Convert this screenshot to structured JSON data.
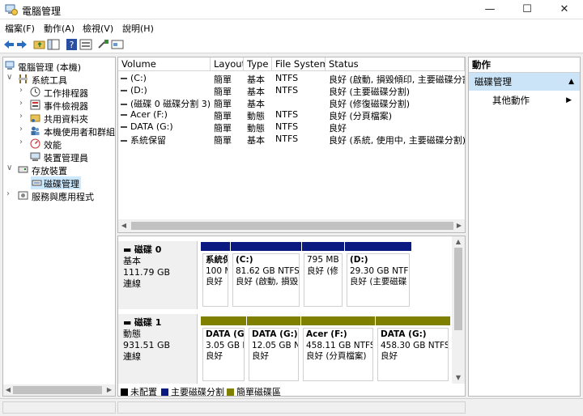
{
  "window": {
    "title": "電腦管理",
    "min": "—",
    "max": "☐",
    "close": "✕"
  },
  "menu": [
    "檔案(F)",
    "動作(A)",
    "檢視(V)",
    "說明(H)"
  ],
  "tree": {
    "root": "電腦管理 (本機)",
    "system_tools": "系統工具",
    "task_scheduler": "工作排程器",
    "event_viewer": "事件檢視器",
    "shared_folders": "共用資料夾",
    "local_users": "本機使用者和群組",
    "performance": "效能",
    "device_manager": "裝置管理員",
    "storage": "存放裝置",
    "disk_management": "磁碟管理",
    "services": "服務與應用程式"
  },
  "list": {
    "columns": [
      "Volume",
      "Layout",
      "Type",
      "File System",
      "Status"
    ],
    "rows": [
      {
        "volume": "(C:)",
        "layout": "簡單",
        "type": "基本",
        "fs": "NTFS",
        "status": "良好 (啟動, 損毀傾印, 主要磁碟分割)"
      },
      {
        "volume": "(D:)",
        "layout": "簡單",
        "type": "基本",
        "fs": "NTFS",
        "status": "良好 (主要磁碟分割)"
      },
      {
        "volume": "(磁碟 0 磁碟分割 3)",
        "layout": "簡單",
        "type": "基本",
        "fs": "",
        "status": "良好 (修復磁碟分割)"
      },
      {
        "volume": "Acer (F:)",
        "layout": "簡單",
        "type": "動態",
        "fs": "NTFS",
        "status": "良好 (分頁檔案)"
      },
      {
        "volume": "DATA (G:)",
        "layout": "簡單",
        "type": "動態",
        "fs": "NTFS",
        "status": "良好"
      },
      {
        "volume": "系統保留",
        "layout": "簡單",
        "type": "基本",
        "fs": "NTFS",
        "status": "良好 (系統, 使用中, 主要磁碟分割)"
      }
    ]
  },
  "disks": [
    {
      "name": "磁碟 0",
      "kind": "基本",
      "size": "111.79 GB",
      "state": "連線",
      "parts": [
        {
          "name": "系統保",
          "size": "100 M",
          "status": "良好"
        },
        {
          "name": "(C:)",
          "size": "81.62 GB NTFS",
          "status": "良好 (啟動, 損毀"
        },
        {
          "name": "",
          "size": "795 MB",
          "status": "良好 (修"
        },
        {
          "name": "(D:)",
          "size": "29.30 GB NTFS",
          "status": "良好 (主要磁碟"
        }
      ]
    },
    {
      "name": "磁碟 1",
      "kind": "動態",
      "size": "931.51 GB",
      "state": "連線",
      "parts": [
        {
          "name": "DATA (G:)",
          "size": "3.05 GB NTFS",
          "status": "良好"
        },
        {
          "name": "DATA (G:)",
          "size": "12.05 GB NTFS",
          "status": "良好"
        },
        {
          "name": "Acer (F:)",
          "size": "458.11 GB NTFS",
          "status": "良好 (分頁檔案)"
        },
        {
          "name": "DATA (G:)",
          "size": "458.30 GB NTFS",
          "status": "良好"
        }
      ]
    }
  ],
  "legend": [
    {
      "label": "未配置",
      "color": "#000000"
    },
    {
      "label": "主要磁碟分割",
      "color": "#0a1a80"
    },
    {
      "label": "簡單磁碟區",
      "color": "#808000"
    }
  ],
  "actions": {
    "header": "動作",
    "selected": "磁碟管理",
    "more": "其他動作"
  },
  "colors": {
    "primary": "#0a1a80",
    "simple": "#808000",
    "selection": "#cce8ff"
  }
}
